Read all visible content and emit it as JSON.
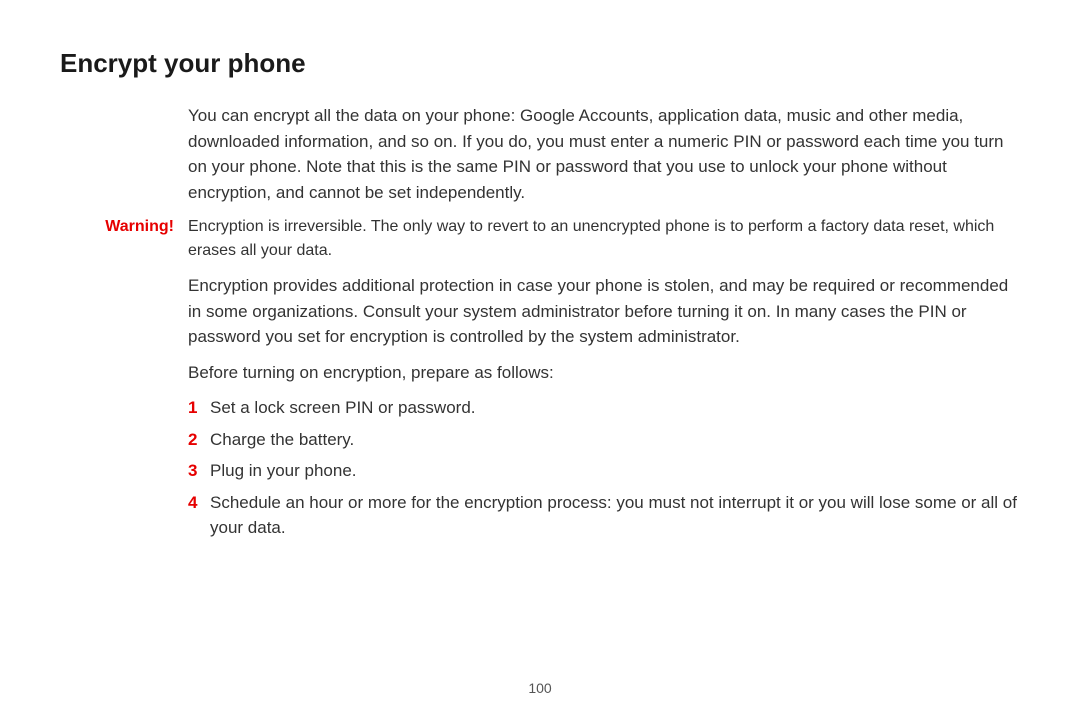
{
  "heading": "Encrypt your phone",
  "intro": "You can encrypt all the data on your phone: Google Accounts, application data, music and other media, downloaded information, and so on. If you do, you must enter a numeric PIN or password each time you turn on your phone. Note that this is the same PIN or password that you use to unlock your phone without encryption, and cannot be set independently.",
  "warning_label": "Warning!",
  "warning_text": "Encryption is irreversible. The only way to revert to an unencrypted phone is to perform a factory data reset, which erases all your data.",
  "para2": "Encryption provides additional protection in case your phone is stolen, and may be required or recommended in some organizations. Consult your system administrator before turning it on. In many cases the PIN or password you set for encryption is controlled by the system administrator.",
  "prepare_intro": "Before turning on encryption, prepare as follows:",
  "steps": [
    {
      "n": "1",
      "text": "Set a lock screen PIN or password."
    },
    {
      "n": "2",
      "text": "Charge the battery."
    },
    {
      "n": "3",
      "text": "Plug in your phone."
    },
    {
      "n": "4",
      "text": "Schedule an hour or more for the encryption process: you must not interrupt it or you will lose some or all of your data."
    }
  ],
  "page_number": "100"
}
